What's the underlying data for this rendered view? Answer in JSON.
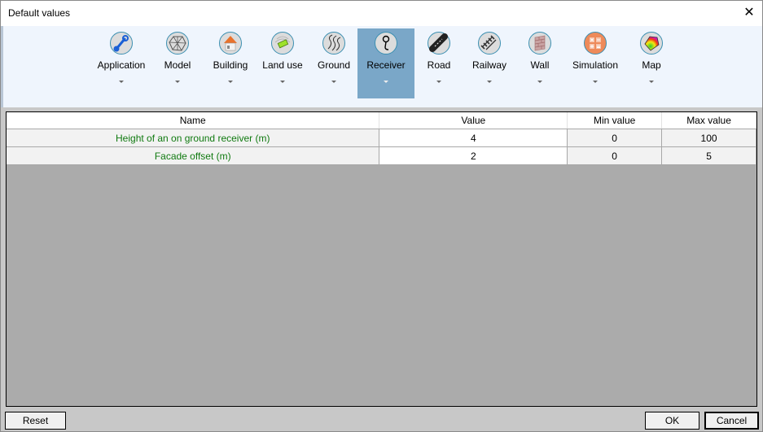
{
  "window": {
    "title": "Default values",
    "close_icon": "close-icon"
  },
  "ribbon": {
    "tabs": [
      {
        "label": "Application",
        "icon": "wrench-icon",
        "selected": false
      },
      {
        "label": "Model",
        "icon": "mesh-icon",
        "selected": false
      },
      {
        "label": "Building",
        "icon": "house-icon",
        "selected": false
      },
      {
        "label": "Land use",
        "icon": "land-use-icon",
        "selected": false
      },
      {
        "label": "Ground",
        "icon": "ground-lines-icon",
        "selected": false
      },
      {
        "label": "Receiver",
        "icon": "receiver-pin-icon",
        "selected": true
      },
      {
        "label": "Road",
        "icon": "road-icon",
        "selected": false
      },
      {
        "label": "Railway",
        "icon": "railway-icon",
        "selected": false
      },
      {
        "label": "Wall",
        "icon": "brick-wall-icon",
        "selected": false
      },
      {
        "label": "Simulation",
        "icon": "calculator-icon",
        "selected": false
      },
      {
        "label": "Map",
        "icon": "color-map-icon",
        "selected": false
      }
    ]
  },
  "grid": {
    "columns": [
      "Name",
      "Value",
      "Min value",
      "Max value"
    ],
    "rows": [
      {
        "name": "Height of an on ground receiver (m)",
        "value": "4",
        "min": "0",
        "max": "100"
      },
      {
        "name": "Facade offset (m)",
        "value": "2",
        "min": "0",
        "max": "5"
      }
    ]
  },
  "buttons": {
    "reset": "Reset",
    "ok": "OK",
    "cancel": "Cancel"
  },
  "colors": {
    "selected_tab": "#7aa7c8",
    "name_text": "#107a10",
    "ribbon_bg": "#eff5fd",
    "grid_bg": "#ababab"
  }
}
